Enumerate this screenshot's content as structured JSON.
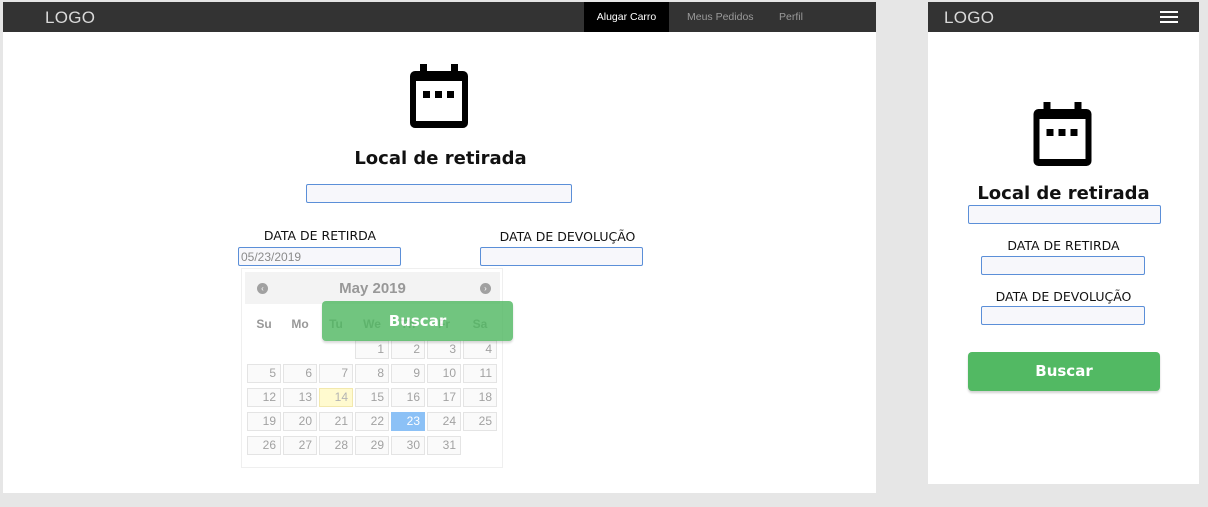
{
  "desktop": {
    "logo": "LOGO",
    "nav": [
      {
        "label": "Alugar Carro",
        "active": true
      },
      {
        "label": "Meus Pedidos",
        "active": false
      },
      {
        "label": "Perfil",
        "active": false
      }
    ],
    "icon": "calendar-icon",
    "title": "Local de retirada",
    "pickup_location": {
      "value": "",
      "placeholder": ""
    },
    "pickup_date_label": "DATA DE RETIRDA",
    "pickup_date_value": "05/23/2019",
    "return_date_label": "DATA DE DEVOLUÇÃO",
    "return_date_value": "",
    "search_label": "Buscar",
    "datepicker": {
      "month": "May 2019",
      "prev_icon": "chevron-left-icon",
      "next_icon": "chevron-right-icon",
      "weekdays": [
        "Su",
        "Mo",
        "Tu",
        "We",
        "Th",
        "Fr",
        "Sa"
      ],
      "weeks": [
        [
          "",
          "",
          "",
          "1",
          "2",
          "3",
          "4"
        ],
        [
          "5",
          "6",
          "7",
          "8",
          "9",
          "10",
          "11"
        ],
        [
          "12",
          "13",
          "14",
          "15",
          "16",
          "17",
          "18"
        ],
        [
          "19",
          "20",
          "21",
          "22",
          "23",
          "24",
          "25"
        ],
        [
          "26",
          "27",
          "28",
          "29",
          "30",
          "31",
          ""
        ]
      ],
      "today": "14",
      "selected": "23"
    }
  },
  "mobile": {
    "logo": "LOGO",
    "menu_icon": "hamburger-menu-icon",
    "icon": "calendar-icon",
    "title": "Local de retirada",
    "pickup_date_label": "DATA DE RETIRDA",
    "return_date_label": "DATA DE DEVOLUÇÃO",
    "search_label": "Buscar"
  },
  "colors": {
    "topbar": "#333333",
    "active_nav": "#000000",
    "accent_green": "#52b963",
    "field_border": "#5b8fd8",
    "selected_day": "#2f8ff0",
    "today_day": "#fff6a8"
  }
}
